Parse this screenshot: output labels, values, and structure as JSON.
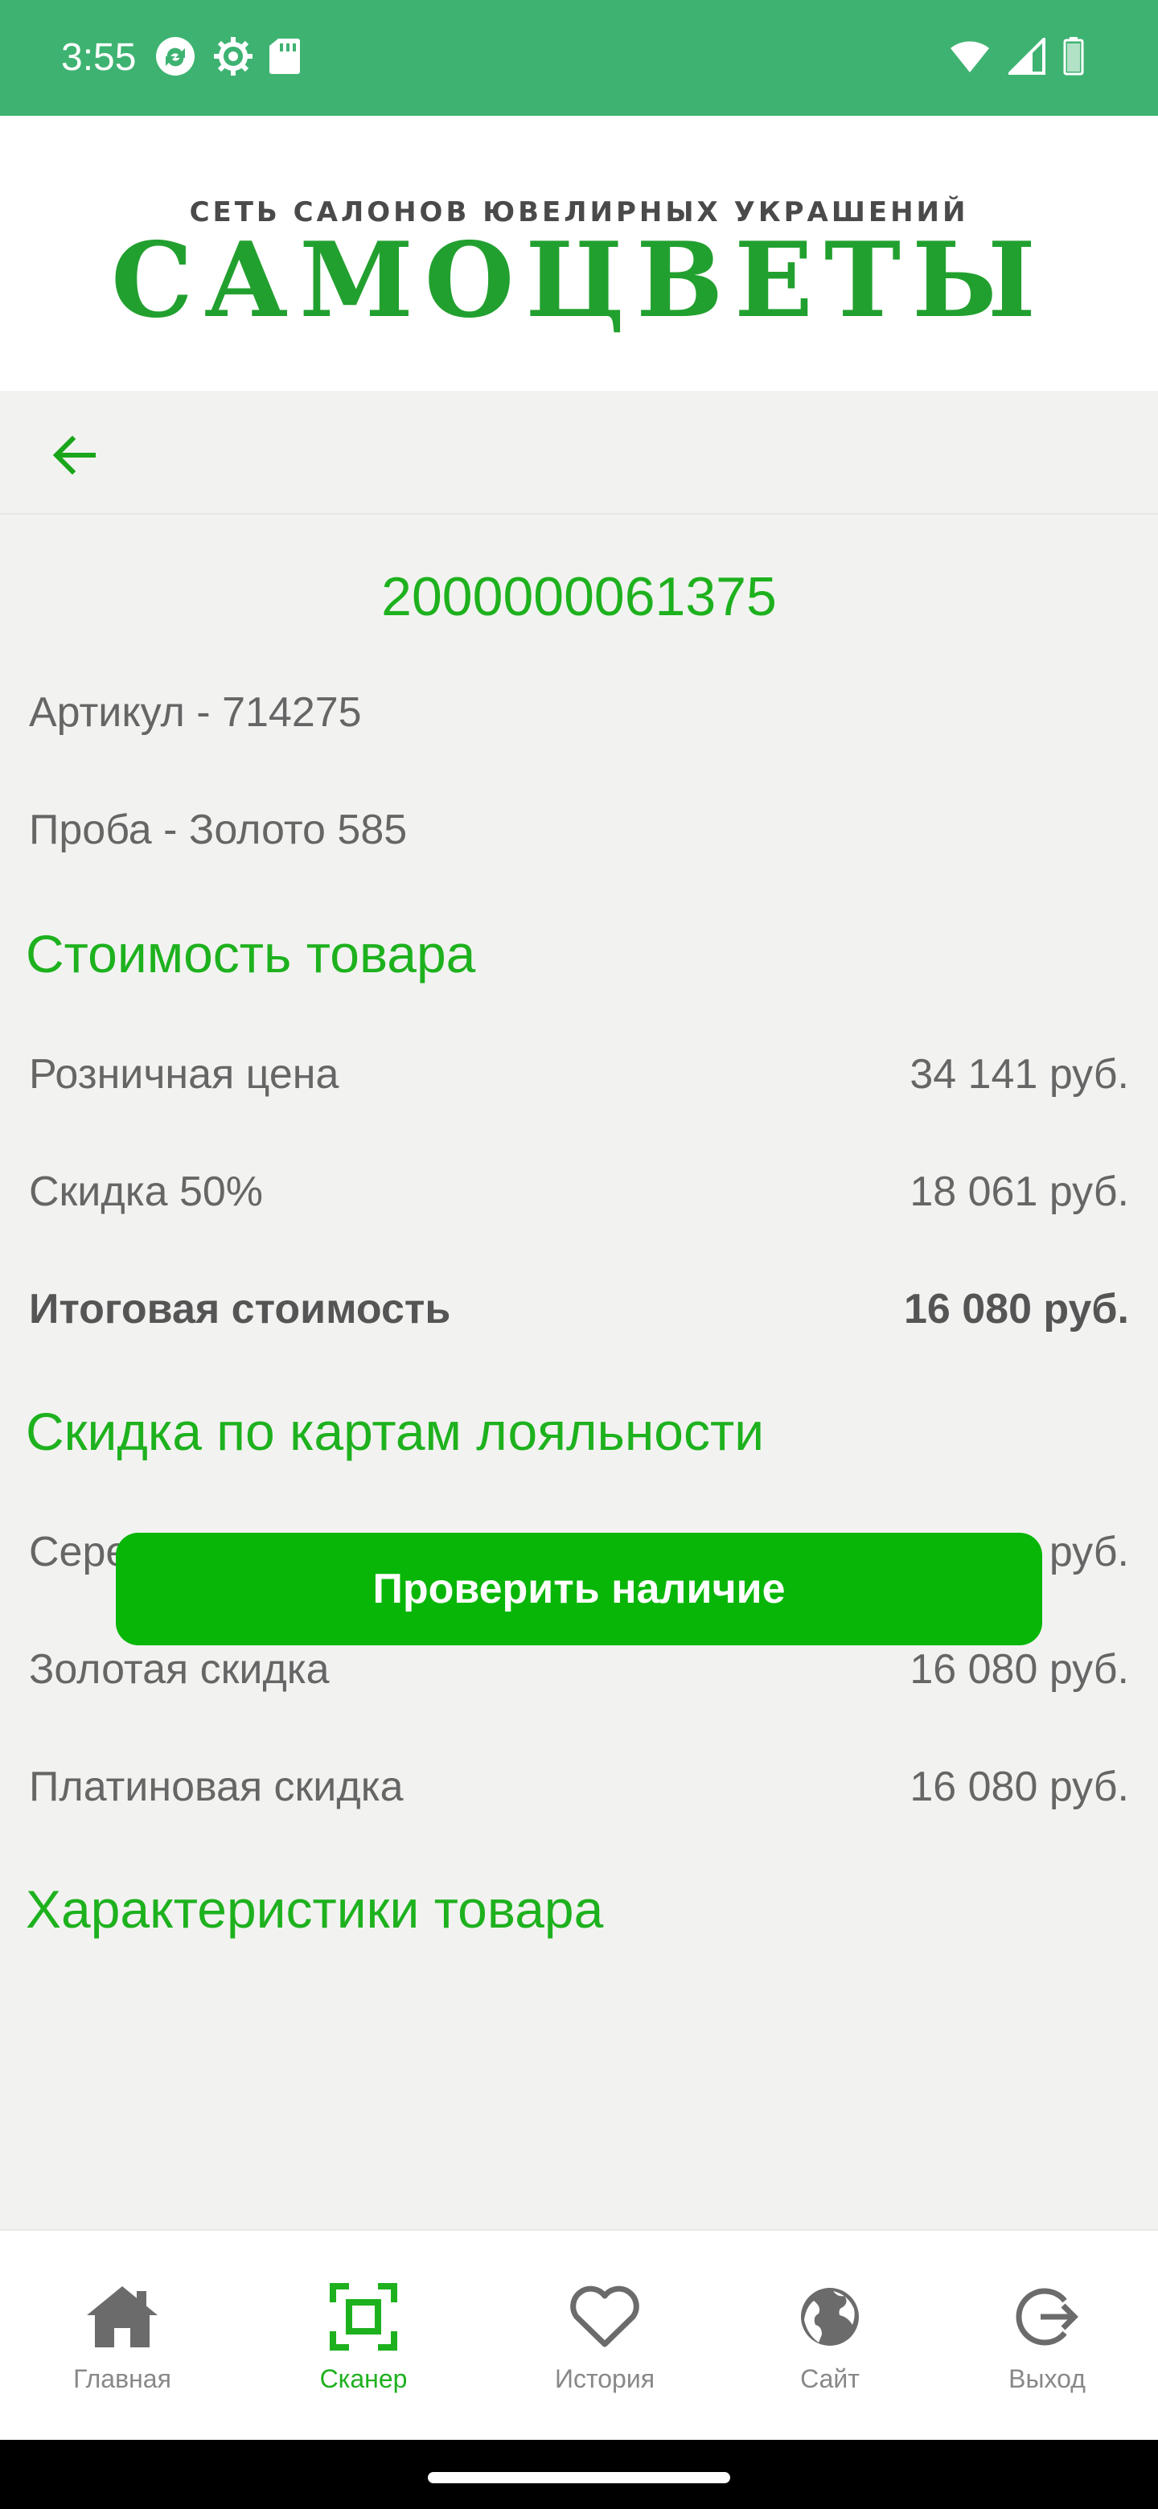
{
  "status_bar": {
    "time": "3:55",
    "icons_left": [
      "sync-icon",
      "settings-icon",
      "sd-card-icon"
    ],
    "icons_right": [
      "wifi-icon",
      "signal-icon",
      "battery-icon"
    ],
    "background": "#3eb371"
  },
  "header": {
    "logo_subtitle": "СЕТЬ САЛОНОВ ЮВЕЛИРНЫХ УКРАШЕНИЙ",
    "logo_title": "САМОЦВЕТЫ",
    "logo_color": "#22a02f"
  },
  "toolbar": {
    "back_icon": "arrow-left-icon"
  },
  "product": {
    "barcode": "2000000061375",
    "article": "Артикул - 714275",
    "assay": "Проба - Золото 585"
  },
  "cost_section": {
    "title": "Стоимость товара",
    "rows": [
      {
        "label": "Розничная цена",
        "value": "34 141 руб."
      },
      {
        "label": "Скидка 50%",
        "value": "18 061 руб."
      },
      {
        "label": "Итоговая стоимость",
        "value": "16 080 руб."
      }
    ]
  },
  "loyalty_section": {
    "title": "Скидка по картам лояльности",
    "rows": [
      {
        "label": "Серебрянная скидка",
        "value": "16 080 руб."
      },
      {
        "label": "Золотая скидка",
        "value": "16 080 руб."
      },
      {
        "label": "Платиновая скидка",
        "value": "16 080 руб."
      }
    ]
  },
  "characteristics_section": {
    "title": "Характеристики товара"
  },
  "check_button": {
    "label": "Проверить наличие",
    "color": "#08b608"
  },
  "bottom_nav": {
    "items": [
      {
        "label": "Главная",
        "icon": "home-icon",
        "active": false
      },
      {
        "label": "Сканер",
        "icon": "scanner-icon",
        "active": true
      },
      {
        "label": "История",
        "icon": "heart-icon",
        "active": false
      },
      {
        "label": "Сайт",
        "icon": "globe-icon",
        "active": false
      },
      {
        "label": "Выход",
        "icon": "logout-icon",
        "active": false
      }
    ],
    "active_color": "#1eb11e",
    "inactive_color": "#888888"
  }
}
